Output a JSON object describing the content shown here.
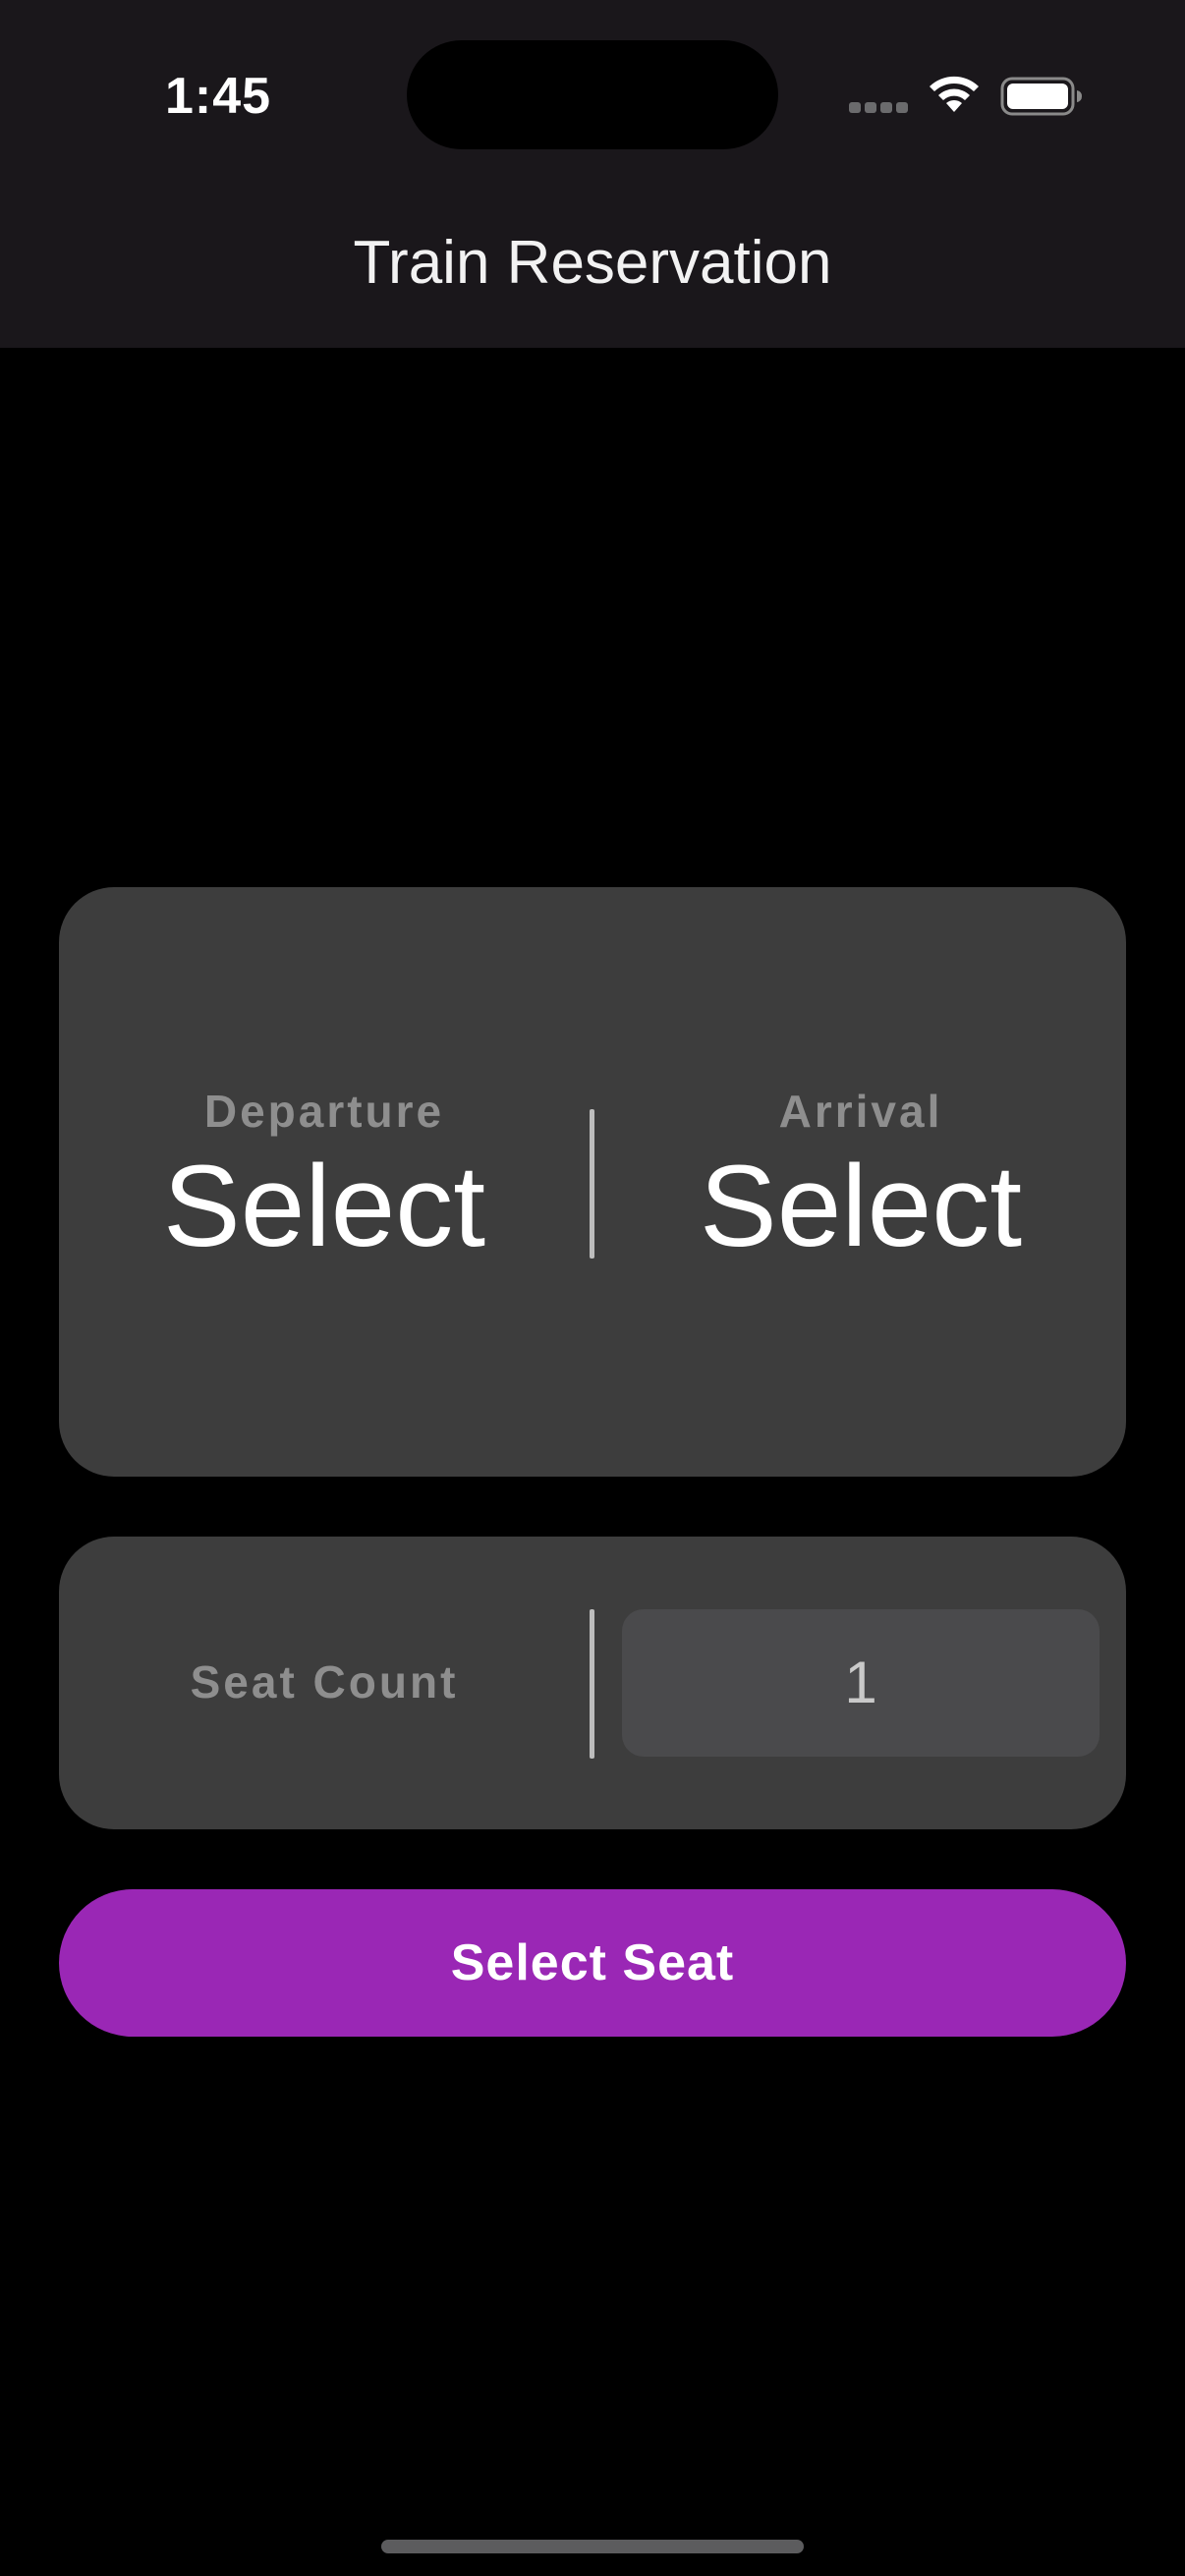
{
  "status_bar": {
    "time": "1:45",
    "signal_icon": "cellular-signal-icon",
    "wifi_icon": "wifi-icon",
    "battery_icon": "battery-icon"
  },
  "nav": {
    "title": "Train Reservation"
  },
  "stations": {
    "departure_label": "Departure",
    "departure_value": "Select",
    "arrival_label": "Arrival",
    "arrival_value": "Select"
  },
  "seats": {
    "label": "Seat Count",
    "value": "1"
  },
  "actions": {
    "select_seat_label": "Select Seat"
  },
  "colors": {
    "background": "#000000",
    "header_background": "#1a171b",
    "card_background": "#3d3d3d",
    "field_background": "#4a4a4c",
    "accent": "#9a27b5",
    "muted_label": "#8e8e8e"
  }
}
